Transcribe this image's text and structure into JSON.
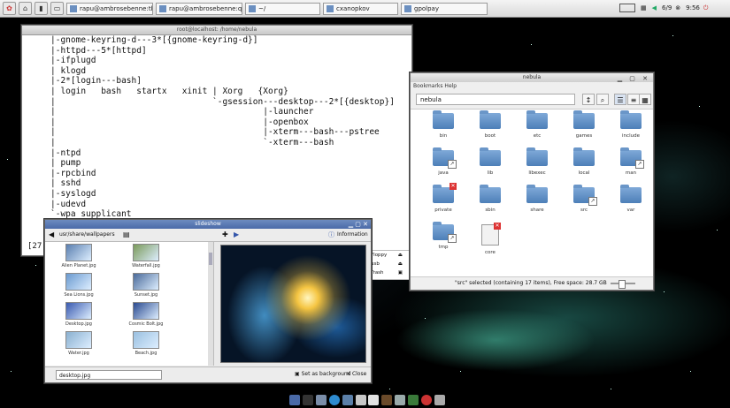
{
  "taskbar": {
    "tasks": [
      "rapu@ambrosebenne:tbaqui",
      "rapu@ambrosebenne:qcnou",
      "~/",
      "cxanopkov",
      "gpolpay"
    ],
    "tray_time": "9:56",
    "tray_label": "6/9"
  },
  "terminal": {
    "title": "root@localhost: /home/nebula",
    "lines": [
      "|-gnome-keyring-d---3*[{gnome-keyring-d}]",
      "|-httpd---5*[httpd]",
      "|-ifplugd",
      "| klogd",
      "|-2*[login---bash]",
      "| login   bash   startx   xinit | Xorg   {Xorg}",
      "|                               `-gsession---desktop---2*[{desktop}]",
      "|                                         |-launcher",
      "|                                         |-openbox",
      "|                                         |-xterm---bash---pstree",
      "|                                         `-xterm---bash",
      "|-ntpd",
      "| pump",
      "|-rpcbind",
      "| sshd",
      "|-syslogd",
      "|-udevd",
      "`-wpa_supplicant"
    ],
    "prompt": "[27..."
  },
  "filemanager": {
    "title": "nebula",
    "menu": "Bookmarks   Help",
    "path": "nebula",
    "items": [
      {
        "label": "bin",
        "type": "folder"
      },
      {
        "label": "boot",
        "type": "folder"
      },
      {
        "label": "etc",
        "type": "folder"
      },
      {
        "label": "games",
        "type": "folder"
      },
      {
        "label": "include",
        "type": "folder"
      },
      {
        "label": "java",
        "type": "link"
      },
      {
        "label": "lib",
        "type": "folder"
      },
      {
        "label": "libexec",
        "type": "folder"
      },
      {
        "label": "local",
        "type": "folder"
      },
      {
        "label": "man",
        "type": "link"
      },
      {
        "label": "private",
        "type": "locked"
      },
      {
        "label": "sbin",
        "type": "folder"
      },
      {
        "label": "share",
        "type": "folder"
      },
      {
        "label": "src",
        "type": "link"
      },
      {
        "label": "var",
        "type": "folder"
      },
      {
        "label": "tmp",
        "type": "link"
      },
      {
        "label": "core",
        "type": "file"
      }
    ],
    "status": "\"src\" selected (containing 17 items), Free space: 28.7 GB",
    "zoom": 0.4
  },
  "volumes": {
    "items": [
      "Floppy",
      "usb",
      "Trash"
    ]
  },
  "viewer": {
    "title": "slideshow",
    "location": "usr/share/wallpapers",
    "info_label": "Information",
    "thumbs": [
      "Alien Planet.jpg",
      "Waterfall.jpg",
      "Sea Lions.jpg",
      "Sunset.jpg",
      "Desktop.jpg",
      "Cosmic Bolt.jpg",
      "Water.jpg",
      "Beach.jpg"
    ],
    "filename": "desktop.jpg",
    "btn_set": "Set as background",
    "btn_close": "Close"
  }
}
